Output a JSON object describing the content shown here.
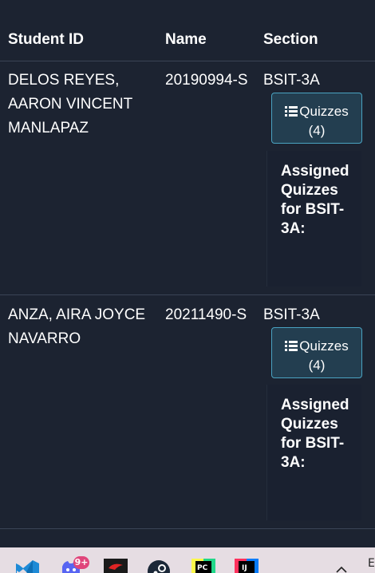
{
  "table": {
    "headers": {
      "student_id": "Student ID",
      "name": "Name",
      "section": "Section"
    },
    "rows": [
      {
        "student_name": "DELOS REYES, AARON VINCENT MANLAPAZ",
        "student_number": "20190994-S",
        "section": "BSIT-3A",
        "quiz_button_label": "Quizzes (4)",
        "panel_heading": "Assigned Quizzes for BSIT-3A:"
      },
      {
        "student_name": "ANZA, AIRA JOYCE NAVARRO",
        "student_number": "20211490-S",
        "section": "BSIT-3A",
        "quiz_button_label": "Quizzes (4)",
        "panel_heading": "Assigned Quizzes for BSIT-3A:"
      }
    ]
  },
  "taskbar": {
    "apps": [
      {
        "icon": "vscode-icon"
      },
      {
        "icon": "discord-icon",
        "badge": "9+"
      },
      {
        "icon": "msi-dragon-icon"
      },
      {
        "icon": "steam-icon"
      },
      {
        "icon": "pycharm-icon",
        "label": "PC"
      },
      {
        "icon": "intellij-icon",
        "label": "IJ"
      }
    ],
    "tray_letter": "E"
  },
  "colors": {
    "background": "#1c2331",
    "button_bg": "#233e50",
    "button_border": "#4aa3c2",
    "divider": "#3a4456",
    "taskbar": "#e6dde3"
  }
}
